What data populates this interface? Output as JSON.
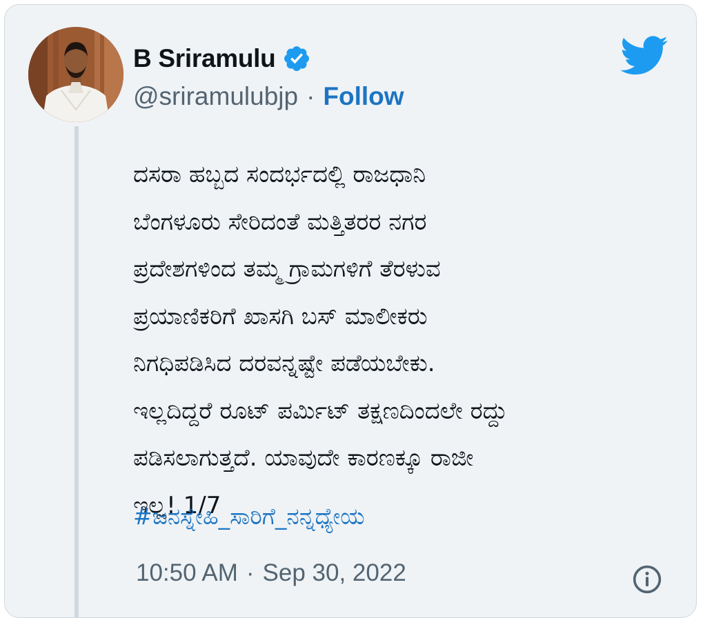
{
  "user": {
    "name": "B Sriramulu",
    "handle": "@sriramulubjp",
    "separator": "·",
    "follow_label": "Follow"
  },
  "tweet": {
    "text": "ದಸರಾ ಹಬ್ಬದ ಸಂದರ್ಭದಲ್ಲಿ ರಾಜಧಾನಿ\nಬೆಂಗಳೂರು ಸೇರಿದಂತೆ ಮತ್ತಿತರರ ನಗರ\nಪ್ರದೇಶಗಳಿಂದ ತಮ್ಮ ಗ್ರಾಮಗಳಿಗೆ ತೆರಳುವ\nಪ್ರಯಾಣಿಕರಿಗೆ ಖಾಸಗಿ ಬಸ್ ಮಾಲೀಕರು\nನಿಗಧಿಪಡಿಸಿದ ದರವನ್ನಷ್ಟೇ ಪಡೆಯಬೇಕು.\nಇಲ್ಲದಿದ್ದರೆ ರೂಟ್ ಪರ್ಮಿಟ್ ತಕ್ಷಣದಿಂದಲೇ ರದ್ದು\nಪಡಿಸಲಾಗುತ್ತದೆ. ಯಾವುದೇ ಕಾರಣಕ್ಕೂ ರಾಜೀ\nಇಲ್ಲ! 1/7",
    "hashtag": "#ಜನಸ್ನೇಹಿ_ಸಾರಿಗೆ_ನನ್ನಧ್ಯೇಯ",
    "time": "10:50 AM",
    "date_separator": "·",
    "date": "Sep 30, 2022"
  },
  "icons": {
    "verified": "verified-badge-icon",
    "brand": "twitter-bird-icon",
    "info": "info-icon"
  },
  "colors": {
    "background": "#eff3f6",
    "accent": "#1d9bf0",
    "link": "#1d74c2",
    "text": "#0f1419",
    "muted": "#536471"
  }
}
